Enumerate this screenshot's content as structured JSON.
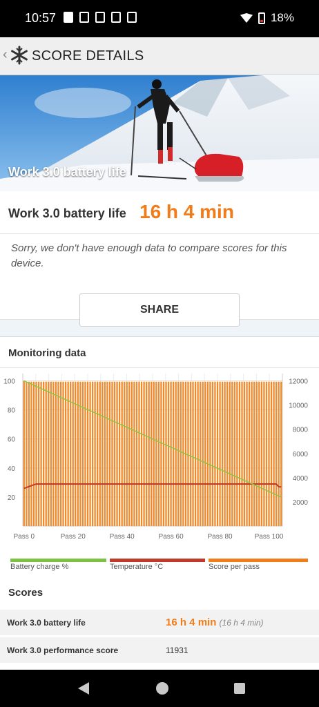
{
  "status_bar": {
    "time": "10:57",
    "battery_percent": "18%"
  },
  "header": {
    "title": "SCORE DETAILS",
    "back_glyph": "‹"
  },
  "hero": {
    "caption": "Work 3.0 battery life",
    "version": "3.0"
  },
  "result": {
    "label": "Work 3.0 battery life",
    "value": "16 h 4 min",
    "note": "Sorry, we don't have enough data to compare scores for this device."
  },
  "share": {
    "label": "SHARE"
  },
  "monitoring": {
    "title": "Monitoring data",
    "legend": [
      {
        "label": "Battery charge %",
        "color": "#7cc242"
      },
      {
        "label": "Temperature °C",
        "color": "#c0392b"
      },
      {
        "label": "Score per pass",
        "color": "#f07d1a"
      }
    ]
  },
  "chart_data": {
    "type": "bar",
    "x_tick_labels": [
      "Pass 0",
      "Pass 20",
      "Pass 40",
      "Pass 60",
      "Pass 80",
      "Pass 100"
    ],
    "y_left_ticks": [
      100,
      80,
      60,
      40,
      20
    ],
    "y_left_range": [
      0,
      105
    ],
    "y_right_ticks": [
      12000,
      10000,
      8000,
      6000,
      4000,
      2000
    ],
    "y_right_range": [
      0,
      12600
    ],
    "grid": true,
    "legend_position": "bottom",
    "passes": 106,
    "series": [
      {
        "name": "Score per pass",
        "axis": "right",
        "values_approx": {
          "all_passes": 11931,
          "first_pass": 12000
        }
      },
      {
        "name": "Battery charge %",
        "axis": "left",
        "start": 100,
        "end": 20
      },
      {
        "name": "Temperature °C",
        "axis": "left",
        "values_approx": {
          "pass_0": 26,
          "pass_5_onward": 29,
          "pass_104_onward": 27
        }
      }
    ]
  },
  "scores": {
    "title": "Scores",
    "rows": [
      {
        "name": "Work 3.0 battery life",
        "value": "16 h 4 min",
        "sub": "(16 h 4 min)"
      },
      {
        "name": "Work 3.0 performance score",
        "value": "11931"
      }
    ]
  }
}
